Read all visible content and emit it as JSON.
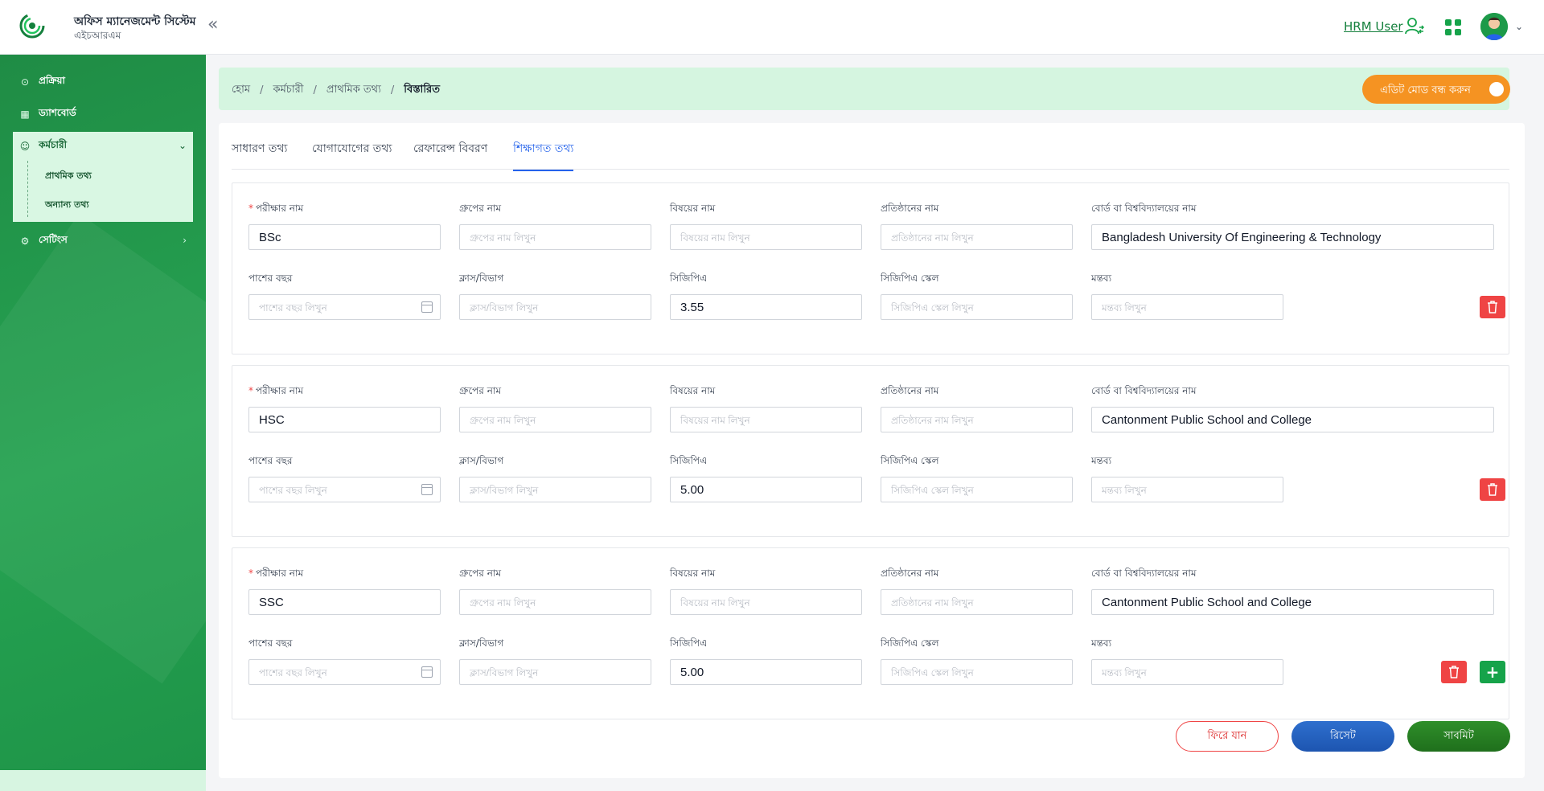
{
  "header": {
    "app_title": "অফিস ম্যানেজমেন্ট সিস্টেম",
    "app_subtitle": "এইচআরএম",
    "user_name": "HRM User",
    "logo_icon": "regulatory-authority-logo",
    "collapse_icon": "double-chevron-left-icon"
  },
  "sidebar": {
    "items": [
      {
        "label": "প্রক্রিয়া",
        "icon": "process-icon"
      },
      {
        "label": "ড্যাশবোর্ড",
        "icon": "dashboard-icon"
      },
      {
        "label": "কর্মচারী",
        "icon": "user-icon",
        "expanded": true,
        "children": [
          {
            "label": "প্রাথমিক তথ্য"
          },
          {
            "label": "অন্যান্য তথ্য"
          }
        ]
      },
      {
        "label": "সেটিংস",
        "icon": "settings-icon"
      }
    ]
  },
  "breadcrumb": {
    "items": [
      "হোম",
      "কর্মচারী",
      "প্রাথমিক তথ্য"
    ],
    "current": "বিস্তারিত"
  },
  "edit_toggle": {
    "label": "এডিট মোড বন্ধ করুন"
  },
  "tabs": [
    {
      "label": "সাধারণ তথ্য"
    },
    {
      "label": "যোগাযোগের তথ্য"
    },
    {
      "label": "রেফারেন্স বিবরণ"
    },
    {
      "label": "শিক্ষাগত তথ্য",
      "active": true
    }
  ],
  "labels": {
    "exam_name": "পরীক্ষার নাম",
    "group_name": "গ্রুপের নাম",
    "subject_name": "বিষয়ের নাম",
    "institution_name": "প্রতিষ্ঠানের নাম",
    "board_name": "বোর্ড বা বিশ্ববিদ্যালয়ের নাম",
    "passing_year": "পাশের বছর",
    "class_division": "ক্লাস/বিভাগ",
    "cgpa": "সিজিপিএ",
    "cgpa_scale": "সিজিপিএ স্কেল",
    "remarks": "মন্তব্য"
  },
  "placeholders": {
    "group_name": "গ্রুপের নাম লিখুন",
    "subject_name": "বিষয়ের নাম লিখুন",
    "institution_name": "প্রতিষ্ঠানের নাম লিখুন",
    "passing_year": "পাশের বছর লিখুন",
    "class_division": "ক্লাস/বিভাগ লিখুন",
    "cgpa_scale": "সিজিপিএ স্কেল লিখুন",
    "remarks": "মন্তব্য লিখুন"
  },
  "education": [
    {
      "exam_name": "BSc",
      "board_name": "Bangladesh University Of Engineering & Technology",
      "cgpa": "3.55"
    },
    {
      "exam_name": "HSC",
      "board_name": "Cantonment Public School and College",
      "cgpa": "5.00"
    },
    {
      "exam_name": "SSC",
      "board_name": "Cantonment Public School and College",
      "cgpa": "5.00"
    }
  ],
  "buttons": {
    "back": "ফিরে যান",
    "reset": "রিসেট",
    "submit": "সাবমিট"
  },
  "colors": {
    "brand_green": "#1f8c45",
    "accent_orange": "#f59322",
    "tab_active": "#2563eb",
    "danger": "#ef4444",
    "reset_blue": "#1d55b0",
    "submit_green": "#1f6f1c"
  }
}
